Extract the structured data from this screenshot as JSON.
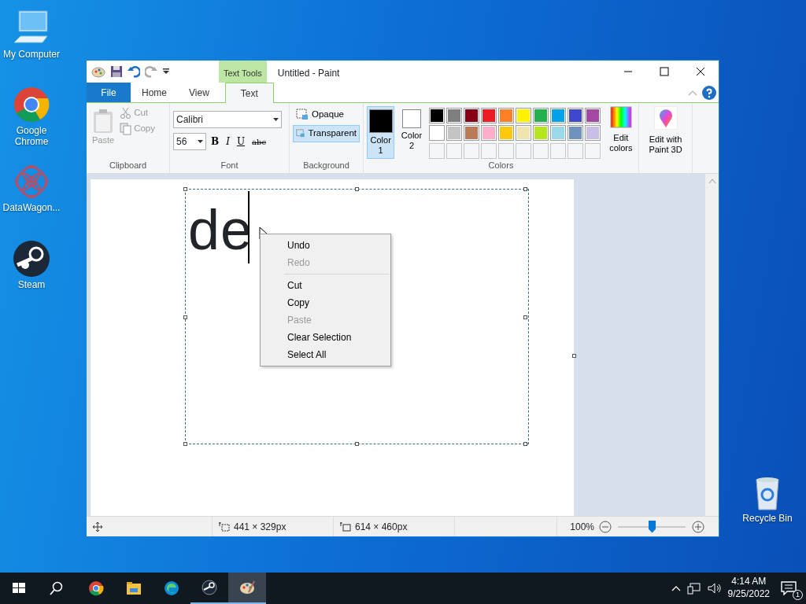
{
  "desktop_icons": [
    {
      "label": "My Computer",
      "kind": "computer"
    },
    {
      "label": "Google Chrome",
      "kind": "chrome"
    },
    {
      "label": "DataWagon...",
      "kind": "mesh"
    },
    {
      "label": "Steam",
      "kind": "steam"
    },
    {
      "label": "Recycle Bin",
      "kind": "bin"
    }
  ],
  "window": {
    "title": "Untitled - Paint",
    "contextual_tab": "Text Tools"
  },
  "ribbon_tabs": [
    {
      "label": "File",
      "kind": "file",
      "selected": false
    },
    {
      "label": "Home",
      "kind": "tab",
      "selected": false
    },
    {
      "label": "View",
      "kind": "tab",
      "selected": false
    },
    {
      "label": "Text",
      "kind": "tab",
      "selected": true
    }
  ],
  "clipboard": {
    "group": "Clipboard",
    "paste": {
      "label": "Paste",
      "disabled": true
    },
    "cut": {
      "label": "Cut",
      "disabled": true
    },
    "copy": {
      "label": "Copy",
      "disabled": true
    }
  },
  "font": {
    "group": "Font",
    "family": "Calibri",
    "size": "56",
    "styles": [
      {
        "label": "B",
        "kind": "bold"
      },
      {
        "label": "I",
        "kind": "italic"
      },
      {
        "label": "U",
        "kind": "underline"
      },
      {
        "label": "abc",
        "kind": "strike"
      }
    ]
  },
  "background": {
    "group": "Background",
    "options": [
      {
        "label": "Opaque",
        "selected": false
      },
      {
        "label": "Transparent",
        "selected": true
      }
    ]
  },
  "colors": {
    "group": "Colors",
    "slots": [
      {
        "label": "Color 1",
        "color": "#000000",
        "selected": true
      },
      {
        "label": "Color 2",
        "color": "#ffffff",
        "selected": false
      }
    ],
    "palette": [
      {
        "color": "#000000"
      },
      {
        "color": "#7f7f7f"
      },
      {
        "color": "#880015"
      },
      {
        "color": "#ed1c24"
      },
      {
        "color": "#ff7f27"
      },
      {
        "color": "#fff200"
      },
      {
        "color": "#22b14c"
      },
      {
        "color": "#00a2e8"
      },
      {
        "color": "#3f48cc"
      },
      {
        "color": "#a349a4"
      },
      {
        "color": "#ffffff"
      },
      {
        "color": "#c3c3c3"
      },
      {
        "color": "#b97a57"
      },
      {
        "color": "#ffaec9"
      },
      {
        "color": "#ffc90e"
      },
      {
        "color": "#efe4b0"
      },
      {
        "color": "#b5e61d"
      },
      {
        "color": "#99d9ea"
      },
      {
        "color": "#7092be"
      },
      {
        "color": "#c8bfe7"
      }
    ],
    "edit_colors": "Edit colors"
  },
  "paint3d": "Edit with Paint 3D",
  "canvas": {
    "text": "de"
  },
  "context_menu": [
    {
      "label": "Undo",
      "kind": "item",
      "disabled": false
    },
    {
      "label": "Redo",
      "kind": "item",
      "disabled": true
    },
    {
      "kind": "separator"
    },
    {
      "label": "Cut",
      "kind": "item",
      "disabled": false
    },
    {
      "label": "Copy",
      "kind": "item",
      "disabled": false
    },
    {
      "label": "Paste",
      "kind": "item",
      "disabled": true
    },
    {
      "label": "Clear Selection",
      "kind": "item",
      "disabled": false
    },
    {
      "label": "Select All",
      "kind": "item",
      "disabled": false
    }
  ],
  "status_bar": {
    "selection_size": "441 × 329px",
    "image_size": "614 × 460px",
    "zoom": "100%",
    "level": 0.5
  },
  "taskbar": {
    "apps": [
      {
        "kind": "start",
        "running": false,
        "selected": false
      },
      {
        "kind": "search",
        "running": false,
        "selected": false
      },
      {
        "kind": "chrome",
        "running": false,
        "selected": false
      },
      {
        "kind": "folder",
        "running": false,
        "selected": false
      },
      {
        "kind": "edge",
        "running": false,
        "selected": false
      },
      {
        "kind": "steam",
        "running": true,
        "selected": false
      },
      {
        "kind": "paint",
        "running": true,
        "selected": true
      }
    ],
    "time": "4:14 AM",
    "date": "9/25/2022",
    "notifications": "1"
  }
}
